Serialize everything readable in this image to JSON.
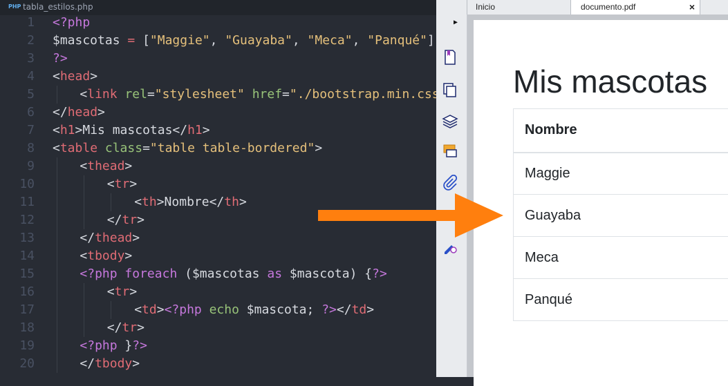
{
  "editor": {
    "file_badge": "PHP",
    "file_name": "tabla_estilos.php",
    "lines": [
      {
        "n": "1",
        "indent": 0,
        "tokens": [
          [
            "php",
            "<?php"
          ]
        ]
      },
      {
        "n": "2",
        "indent": 0,
        "tokens": [
          [
            "var",
            "$mascotas"
          ],
          [
            "plain",
            " "
          ],
          [
            "tag",
            "="
          ],
          [
            "plain",
            " ["
          ],
          [
            "str",
            "\"Maggie\""
          ],
          [
            "plain",
            ", "
          ],
          [
            "str",
            "\"Guayaba\""
          ],
          [
            "plain",
            ", "
          ],
          [
            "str",
            "\"Meca\""
          ],
          [
            "plain",
            ", "
          ],
          [
            "str",
            "\"Panqué\""
          ],
          [
            "plain",
            "];"
          ]
        ]
      },
      {
        "n": "3",
        "indent": 0,
        "tokens": [
          [
            "php",
            "?>"
          ]
        ]
      },
      {
        "n": "4",
        "indent": 0,
        "tokens": [
          [
            "plain",
            "<"
          ],
          [
            "tag",
            "head"
          ],
          [
            "plain",
            ">"
          ]
        ]
      },
      {
        "n": "5",
        "indent": 1,
        "tokens": [
          [
            "plain",
            "<"
          ],
          [
            "tag",
            "link"
          ],
          [
            "plain",
            " "
          ],
          [
            "attr",
            "rel"
          ],
          [
            "plain",
            "="
          ],
          [
            "str",
            "\"stylesheet\""
          ],
          [
            "plain",
            " "
          ],
          [
            "attr",
            "href"
          ],
          [
            "plain",
            "="
          ],
          [
            "str",
            "\"./bootstrap.min.css\""
          ],
          [
            "plain",
            ">"
          ]
        ]
      },
      {
        "n": "6",
        "indent": 0,
        "tokens": [
          [
            "plain",
            "</"
          ],
          [
            "tag",
            "head"
          ],
          [
            "plain",
            ">"
          ]
        ]
      },
      {
        "n": "7",
        "indent": 0,
        "tokens": [
          [
            "plain",
            "<"
          ],
          [
            "tag",
            "h1"
          ],
          [
            "plain",
            ">Mis mascotas</"
          ],
          [
            "tag",
            "h1"
          ],
          [
            "plain",
            ">"
          ]
        ]
      },
      {
        "n": "8",
        "indent": 0,
        "tokens": [
          [
            "plain",
            "<"
          ],
          [
            "tag",
            "table"
          ],
          [
            "plain",
            " "
          ],
          [
            "attr",
            "class"
          ],
          [
            "plain",
            "="
          ],
          [
            "str",
            "\"table table-bordered\""
          ],
          [
            "plain",
            ">"
          ]
        ]
      },
      {
        "n": "9",
        "indent": 1,
        "tokens": [
          [
            "plain",
            "<"
          ],
          [
            "tag",
            "thead"
          ],
          [
            "plain",
            ">"
          ]
        ]
      },
      {
        "n": "10",
        "indent": 2,
        "tokens": [
          [
            "plain",
            "<"
          ],
          [
            "tag",
            "tr"
          ],
          [
            "plain",
            ">"
          ]
        ]
      },
      {
        "n": "11",
        "indent": 3,
        "tokens": [
          [
            "plain",
            "<"
          ],
          [
            "tag",
            "th"
          ],
          [
            "plain",
            ">Nombre</"
          ],
          [
            "tag",
            "th"
          ],
          [
            "plain",
            ">"
          ]
        ]
      },
      {
        "n": "12",
        "indent": 2,
        "tokens": [
          [
            "plain",
            "</"
          ],
          [
            "tag",
            "tr"
          ],
          [
            "plain",
            ">"
          ]
        ]
      },
      {
        "n": "13",
        "indent": 1,
        "tokens": [
          [
            "plain",
            "</"
          ],
          [
            "tag",
            "thead"
          ],
          [
            "plain",
            ">"
          ]
        ]
      },
      {
        "n": "14",
        "indent": 1,
        "tokens": [
          [
            "plain",
            "<"
          ],
          [
            "tag",
            "tbody"
          ],
          [
            "plain",
            ">"
          ]
        ]
      },
      {
        "n": "15",
        "indent": 1,
        "tokens": [
          [
            "php",
            "<?php"
          ],
          [
            "plain",
            " "
          ],
          [
            "kw",
            "foreach"
          ],
          [
            "plain",
            " ("
          ],
          [
            "var",
            "$mascotas"
          ],
          [
            "plain",
            " "
          ],
          [
            "kw",
            "as"
          ],
          [
            "plain",
            " "
          ],
          [
            "var",
            "$mascota"
          ],
          [
            "plain",
            ") {"
          ],
          [
            "php",
            "?>"
          ]
        ]
      },
      {
        "n": "16",
        "indent": 2,
        "tokens": [
          [
            "plain",
            "<"
          ],
          [
            "tag",
            "tr"
          ],
          [
            "plain",
            ">"
          ]
        ]
      },
      {
        "n": "17",
        "indent": 3,
        "tokens": [
          [
            "plain",
            "<"
          ],
          [
            "tag",
            "td"
          ],
          [
            "plain",
            ">"
          ],
          [
            "php",
            "<?php"
          ],
          [
            "plain",
            " "
          ],
          [
            "attr",
            "echo"
          ],
          [
            "plain",
            " "
          ],
          [
            "var",
            "$mascota"
          ],
          [
            "plain",
            "; "
          ],
          [
            "php",
            "?>"
          ],
          [
            "plain",
            "</"
          ],
          [
            "tag",
            "td"
          ],
          [
            "plain",
            ">"
          ]
        ]
      },
      {
        "n": "18",
        "indent": 2,
        "tokens": [
          [
            "plain",
            "</"
          ],
          [
            "tag",
            "tr"
          ],
          [
            "plain",
            ">"
          ]
        ]
      },
      {
        "n": "19",
        "indent": 1,
        "tokens": [
          [
            "php",
            "<?php"
          ],
          [
            "plain",
            " }"
          ],
          [
            "php",
            "?>"
          ]
        ]
      },
      {
        "n": "20",
        "indent": 1,
        "tokens": [
          [
            "plain",
            "</"
          ],
          [
            "tag",
            "tbody"
          ],
          [
            "plain",
            ">"
          ]
        ]
      }
    ]
  },
  "viewer": {
    "tabs": [
      {
        "label": "Inicio"
      },
      {
        "label": "documento.pdf",
        "close": "×"
      }
    ],
    "pdf": {
      "title": "Mis mascotas",
      "table_header": "Nombre",
      "rows": [
        "Maggie",
        "Guayaba",
        "Meca",
        "Panqué"
      ]
    },
    "sidebar_icons": [
      "bookmark-icon",
      "pages-icon",
      "layers-icon",
      "comments-icon",
      "attachment-icon",
      "signature-icon"
    ]
  },
  "colors": {
    "arrow": "#ff7f0e",
    "editor_bg": "#282c34"
  }
}
